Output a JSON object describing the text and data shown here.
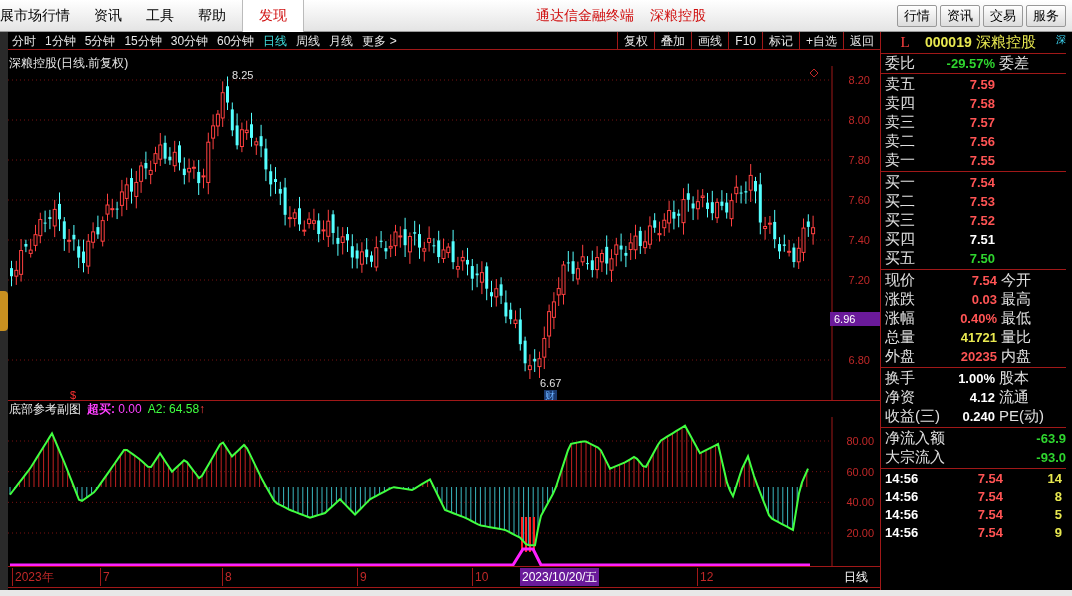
{
  "menu_bar": {
    "items": [
      "展市场行情",
      "资讯",
      "工具",
      "帮助"
    ],
    "discover_tab": "发现",
    "title": "通达信金融终端",
    "stock_name": "深粮控股",
    "buttons": [
      "行情",
      "资讯",
      "交易",
      "服务"
    ]
  },
  "period_tabs": [
    {
      "label": "分时",
      "selected": false
    },
    {
      "label": "1分钟",
      "selected": false
    },
    {
      "label": "5分钟",
      "selected": false
    },
    {
      "label": "15分钟",
      "selected": false
    },
    {
      "label": "30分钟",
      "selected": false
    },
    {
      "label": "60分钟",
      "selected": false
    },
    {
      "label": "日线",
      "selected": true
    },
    {
      "label": "周线",
      "selected": false
    },
    {
      "label": "月线",
      "selected": false
    },
    {
      "label": "更多 >",
      "selected": false
    }
  ],
  "toolbar_buttons": [
    "复权",
    "叠加",
    "画线",
    "F10",
    "标记",
    "+自选",
    "返回"
  ],
  "price_chart": {
    "title": "深粮控股(日线.前复权)",
    "y_ticks": [
      "8.20",
      "8.00",
      "7.80",
      "7.60",
      "7.40",
      "7.20",
      "6.80"
    ],
    "high_label": "8.25",
    "low_label": "6.67",
    "cursor_price": "6.96",
    "finance_marker": "财",
    "signal_marker": "$"
  },
  "indicator": {
    "title": "底部参考副图",
    "overbought_label": "超买:",
    "overbought_value": "0.00",
    "a2_label": "A2:",
    "a2_value": "64.58",
    "arrow": "↑",
    "y_ticks": [
      "80.00",
      "60.00",
      "40.00",
      "20.00"
    ]
  },
  "date_axis": {
    "labels": [
      "2023年",
      "7",
      "8",
      "9",
      "10",
      "12"
    ],
    "cursor_date": "2023/10/20/五",
    "period": "日线"
  },
  "quote": {
    "market_flag": "L",
    "code": "000019",
    "name": "深粮控股",
    "exchange": "深",
    "ratio": {
      "label": "委比",
      "value": "-29.57%",
      "extra": "委差"
    },
    "asks": [
      {
        "label": "卖五",
        "price": "7.59",
        "color": "#ff5454"
      },
      {
        "label": "卖四",
        "price": "7.58",
        "color": "#ff5454"
      },
      {
        "label": "卖三",
        "price": "7.57",
        "color": "#ff5454"
      },
      {
        "label": "卖二",
        "price": "7.56",
        "color": "#ff5454"
      },
      {
        "label": "卖一",
        "price": "7.55",
        "color": "#ff5454"
      }
    ],
    "bids": [
      {
        "label": "买一",
        "price": "7.54",
        "color": "#ff5454"
      },
      {
        "label": "买二",
        "price": "7.53",
        "color": "#ff5454"
      },
      {
        "label": "买三",
        "price": "7.52",
        "color": "#ff5454"
      },
      {
        "label": "买四",
        "price": "7.51",
        "color": "#ffffff"
      },
      {
        "label": "买五",
        "price": "7.50",
        "color": "#2fd52f"
      }
    ],
    "stats": [
      {
        "label": "现价",
        "value": "7.54",
        "color": "#ff5454",
        "extra": "今开"
      },
      {
        "label": "涨跌",
        "value": "0.03",
        "color": "#ff5454",
        "extra": "最高"
      },
      {
        "label": "涨幅",
        "value": "0.40%",
        "color": "#ff5454",
        "extra": "最低"
      },
      {
        "label": "总量",
        "value": "41721",
        "color": "#e8e850",
        "extra": "量比"
      },
      {
        "label": "外盘",
        "value": "20235",
        "color": "#ff5454",
        "extra": "内盘"
      }
    ],
    "fundamentals": [
      {
        "label": "换手",
        "value": "1.00%",
        "extra": "股本"
      },
      {
        "label": "净资",
        "value": "4.12",
        "extra": "流通"
      },
      {
        "label": "收益(三)",
        "value": "0.240",
        "extra": "PE(动)"
      }
    ],
    "flows": [
      {
        "label": "净流入额",
        "value": "-63.9"
      },
      {
        "label": "大宗流入",
        "value": "-93.0"
      }
    ],
    "trades": [
      {
        "time": "14:56",
        "price": "7.54",
        "volume": "14"
      },
      {
        "time": "14:56",
        "price": "7.54",
        "volume": "8"
      },
      {
        "time": "14:56",
        "price": "7.54",
        "volume": "5"
      },
      {
        "time": "14:56",
        "price": "7.54",
        "volume": "9"
      }
    ]
  }
}
